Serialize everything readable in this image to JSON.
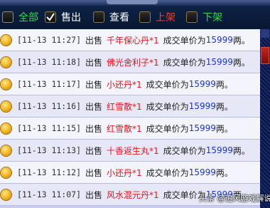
{
  "filters": [
    {
      "label": "全部",
      "checked": false,
      "color": "#2fdc46"
    },
    {
      "label": "售出",
      "checked": true,
      "color": "#ffffff"
    },
    {
      "label": "查看",
      "checked": false,
      "color": "#ffffff"
    },
    {
      "label": "上架",
      "checked": false,
      "color": "#ff3b22"
    },
    {
      "label": "下架",
      "checked": false,
      "color": "#2fdc46"
    }
  ],
  "records": [
    {
      "time": "[11-13 11:27]",
      "action": "出售",
      "item": "千年保心丹*1",
      "deal": "成交单价为",
      "price": "15999",
      "unit": "两。"
    },
    {
      "time": "[11-13 11:18]",
      "action": "出售",
      "item": "佛光舍利子*1",
      "deal": "成交单价为",
      "price": "15999",
      "unit": "两。"
    },
    {
      "time": "[11-13 11:17]",
      "action": "出售",
      "item": "小还丹*1",
      "deal": "成交单价为",
      "price": "15999",
      "unit": "两。"
    },
    {
      "time": "[11-13 11:16]",
      "action": "出售",
      "item": "红雪散*1",
      "deal": "成交单价为",
      "price": "15999",
      "unit": "两。"
    },
    {
      "time": "[11-13 11:15]",
      "action": "出售",
      "item": "红雪散*1",
      "deal": "成交单价为",
      "price": "15999",
      "unit": "两。"
    },
    {
      "time": "[11-13 11:13]",
      "action": "出售",
      "item": "十香返生丸*1",
      "deal": "成交单价为",
      "price": "15999",
      "unit": "两。"
    },
    {
      "time": "[11-13 11:12]",
      "action": "出售",
      "item": "小还丹*1",
      "deal": "成交单价为",
      "price": "15999",
      "unit": "两。"
    },
    {
      "time": "[11-13 11:07]",
      "action": "出售",
      "item": "风水混元丹*1",
      "deal": "成交单价为",
      "price": "15999",
      "unit": "两。"
    }
  ],
  "watermark": "头条 @追风游戏解说"
}
